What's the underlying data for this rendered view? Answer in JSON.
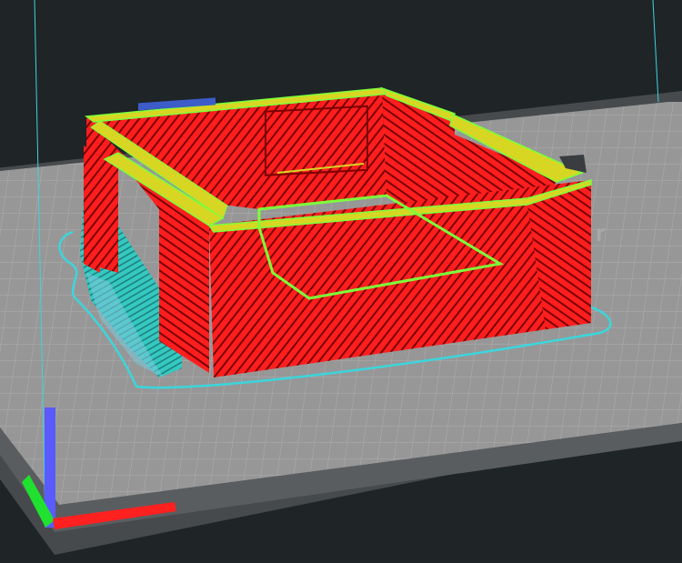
{
  "app": {
    "view": "layer-preview"
  },
  "colors": {
    "background": "#1f2427",
    "bed_top": "#9a9a9a",
    "bed_edge": "#4a4a4a",
    "grid_line": "#aeaeae",
    "outer_wall": "#ff1e1e",
    "wall_line": "#8b0000",
    "top_infill": "#d6d623",
    "perimeter_outline": "#7cff3a",
    "support": "#35c8c0",
    "skirt": "#3bd6dc",
    "axis_x": "#ff2020",
    "axis_y": "#20e030",
    "axis_z": "#5a5aff"
  },
  "legend_items": [
    "outer-wall",
    "top-infill",
    "perimeter",
    "support",
    "skirt"
  ]
}
